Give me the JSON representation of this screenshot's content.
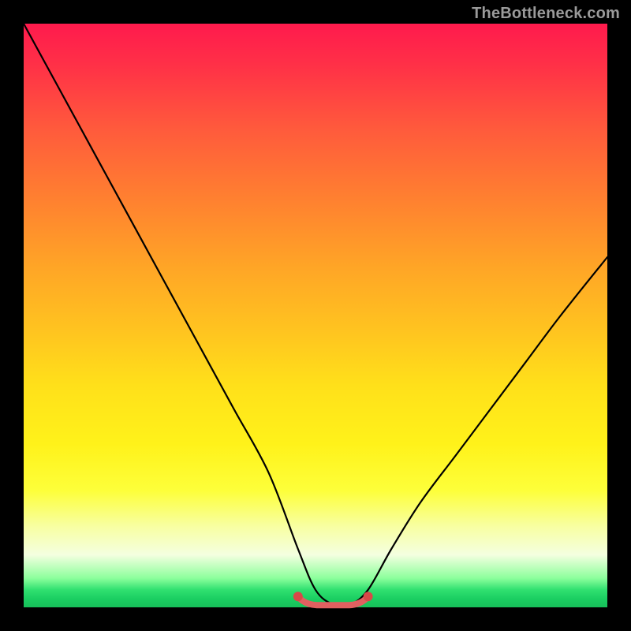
{
  "watermark": "TheBottleneck.com",
  "colors": {
    "page_bg": "#000000",
    "curve": "#000000",
    "basin_stroke": "#e06060",
    "basin_dot": "#d84848"
  },
  "chart_data": {
    "type": "line",
    "title": "",
    "xlabel": "",
    "ylabel": "",
    "xlim": [
      0,
      100
    ],
    "ylim": [
      0,
      100
    ],
    "grid": false,
    "series": [
      {
        "name": "bottleneck-curve",
        "x": [
          0,
          6,
          12,
          18,
          24,
          30,
          36,
          42,
          47,
          50,
          53,
          56,
          59,
          63,
          68,
          74,
          80,
          86,
          92,
          100
        ],
        "values": [
          100,
          89,
          78,
          67,
          56,
          45,
          34,
          23,
          10,
          3,
          0.5,
          0.5,
          3,
          10,
          18,
          26,
          34,
          42,
          50,
          60
        ]
      }
    ],
    "basin": {
      "x_start": 47,
      "x_end": 59,
      "value": 0.5
    }
  }
}
